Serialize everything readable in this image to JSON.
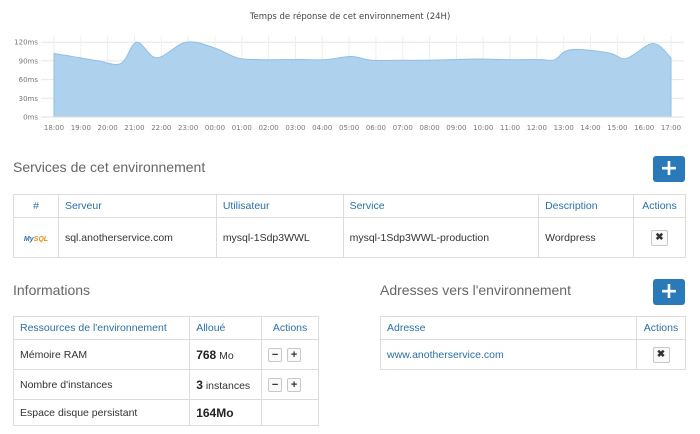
{
  "chart_data": {
    "type": "area",
    "title": "Temps de réponse de cet environnement (24H)",
    "x": [
      "18:00",
      "19:00",
      "20:00",
      "21:00",
      "22:00",
      "23:00",
      "00:00",
      "01:00",
      "02:00",
      "03:00",
      "04:00",
      "05:00",
      "06:00",
      "07:00",
      "08:00",
      "09:00",
      "10:00",
      "11:00",
      "12:00",
      "13:00",
      "14:00",
      "15:00",
      "16:00",
      "17:00"
    ],
    "y_ticks": [
      "0ms",
      "30ms",
      "60ms",
      "90ms",
      "120ms"
    ],
    "ylim": [
      0,
      130
    ],
    "series": [
      {
        "values": [
          102,
          96,
          90,
          86,
          120,
          95,
          120,
          112,
          95,
          92,
          92,
          92,
          92,
          97,
          91,
          91,
          91,
          92,
          93,
          92,
          92,
          92,
          92,
          108,
          103,
          94,
          118,
          95
        ]
      }
    ],
    "x_points": [
      "18:00",
      "18:50",
      "19:40",
      "20:30",
      "21:05",
      "21:50",
      "22:55",
      "23:55",
      "00:50",
      "01:40",
      "02:30",
      "03:20",
      "04:10",
      "05:05",
      "05:50",
      "06:50",
      "07:50",
      "08:50",
      "09:50",
      "10:50",
      "11:30",
      "12:10",
      "12:40",
      "13:15",
      "14:40",
      "15:20",
      "16:20",
      "17:00"
    ],
    "grid": true,
    "color": "#aed1ee",
    "line_color": "#8fbfe6"
  },
  "services": {
    "title": "Services de cet environnement",
    "add_label": "+",
    "columns": [
      "#",
      "Serveur",
      "Utilisateur",
      "Service",
      "Description",
      "Actions"
    ],
    "rows": [
      {
        "logo": "MySQL",
        "server": "sql.anotherservice.com",
        "user": "mysql-1Sdp3WWL",
        "service": "mysql-1Sdp3WWL-production",
        "description": "Wordpress",
        "delete_label": "✖"
      }
    ]
  },
  "informations": {
    "title": "Informations",
    "columns": [
      "Ressources de l'environnement",
      "Alloué",
      "Actions"
    ],
    "rows": [
      {
        "label": "Mémoire RAM",
        "value": "768",
        "unit": "Mo"
      },
      {
        "label": "Nombre d'instances",
        "value": "3",
        "unit": "instances"
      },
      {
        "label": "Espace disque persistant",
        "value": "164Mo",
        "unit": ""
      }
    ],
    "minus_label": "−",
    "plus_label": "+"
  },
  "addresses": {
    "title": "Adresses vers l'environnement",
    "add_label": "+",
    "columns": [
      "Adresse",
      "Actions"
    ],
    "rows": [
      {
        "address": "www.anotherservice.com",
        "delete_label": "✖"
      }
    ]
  }
}
